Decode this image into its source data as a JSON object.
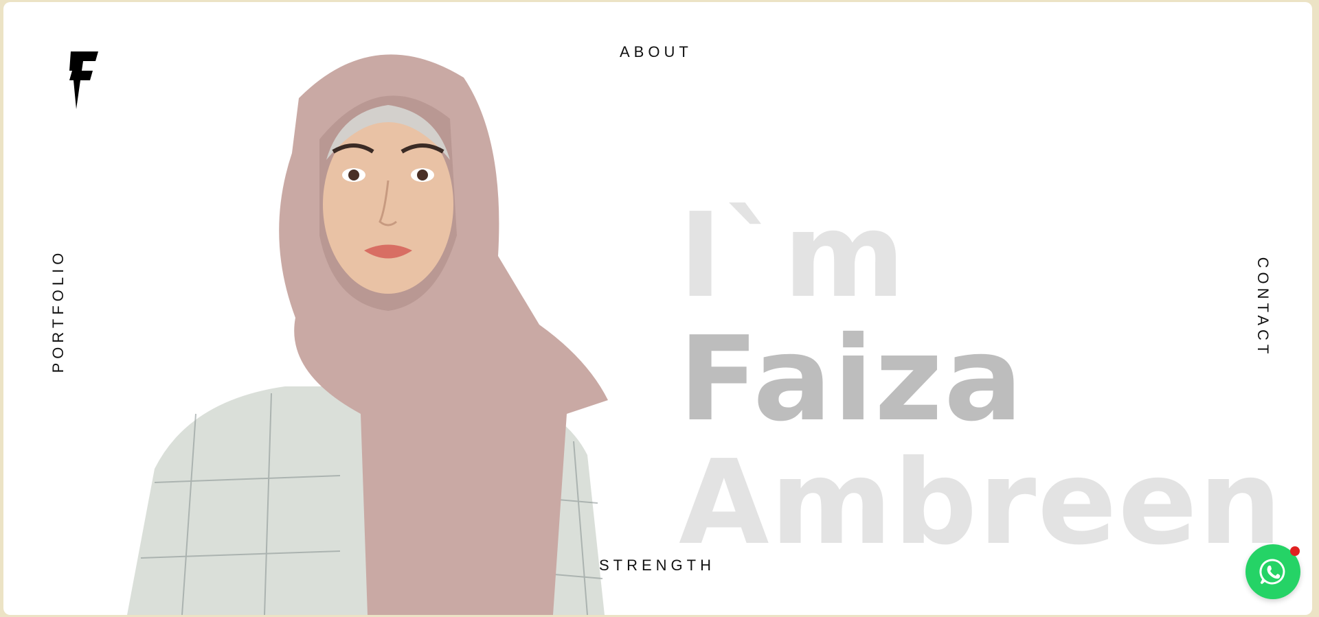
{
  "nav": {
    "about": "ABOUT",
    "strength": "STRENGTH",
    "portfolio": "PORTFOLIO",
    "contact": "CONTACT"
  },
  "hero": {
    "line1": "I`m",
    "line2": "Faiza",
    "line3": "Ambreen"
  },
  "logo": {
    "icon": "lightning-f-logo"
  },
  "chat": {
    "icon": "whatsapp-icon"
  },
  "colors": {
    "page_border": "#ece3c5",
    "background": "#ffffff",
    "headline_light": "#e3e3e3",
    "headline_dark": "#2a2a2a",
    "whatsapp_green": "#25d366",
    "notification_red": "#e02020"
  }
}
